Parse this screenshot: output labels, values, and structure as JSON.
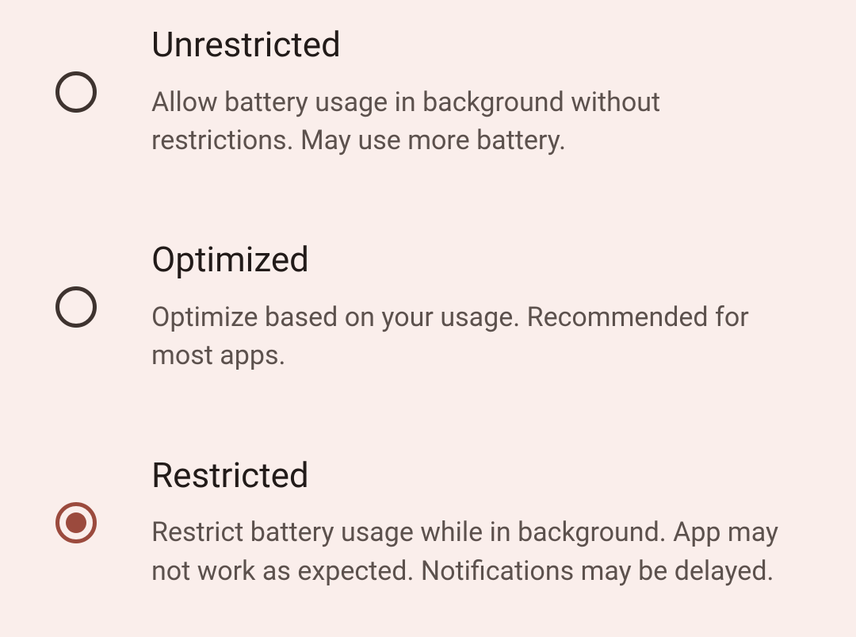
{
  "options": [
    {
      "id": "unrestricted",
      "title": "Unrestricted",
      "description": "Allow battery usage in background without restrictions. May use more battery.",
      "selected": false
    },
    {
      "id": "optimized",
      "title": "Optimized",
      "description": "Optimize based on your usage. Recommended for most apps.",
      "selected": false
    },
    {
      "id": "restricted",
      "title": "Restricted",
      "description": "Restrict battery usage while in background. App may not work as expected. Notifications may be delayed.",
      "selected": true
    }
  ],
  "colors": {
    "background": "#faeeeb",
    "title": "#221b19",
    "description": "#5c514d",
    "radio_unselected": "#3e332f",
    "radio_selected": "#9b4a3d"
  }
}
